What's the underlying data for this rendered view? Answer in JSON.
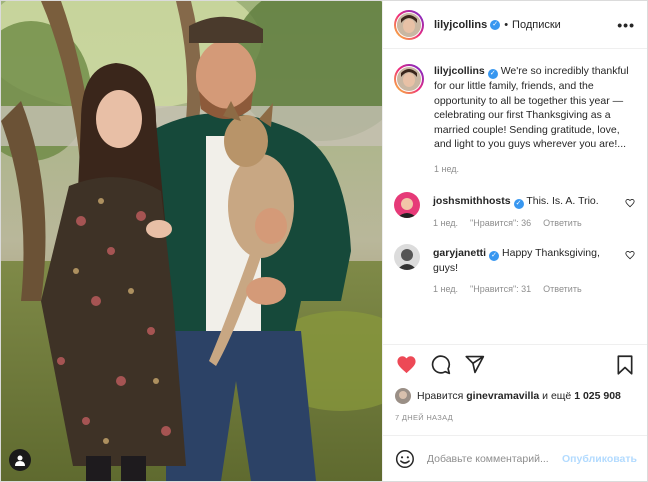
{
  "post": {
    "author": "lilyjcollins",
    "follow_state": "Подписки",
    "caption": "We're so incredibly thankful for our little family, friends, and the opportunity to all be together this year — celebrating our first Thanksgiving as a married couple! Sending gratitude, love, and light to you guys wherever you are!...",
    "caption_age": "1 нед."
  },
  "comments": [
    {
      "user": "joshsmithhosts",
      "text": "This. Is. A. Trio.",
      "age": "1 нед.",
      "likes": "\"Нравится\": 36",
      "reply": "Ответить"
    },
    {
      "user": "garyjanetti",
      "text": "Happy Thanksgiving, guys!",
      "age": "1 нед.",
      "likes": "\"Нравится\": 31",
      "reply": "Ответить"
    }
  ],
  "likes": {
    "prefix": "Нравится",
    "user": "ginevramavilla",
    "mid": "и ещё",
    "count": "1 025 908"
  },
  "posted_at": "7 ДНЕЙ НАЗАД",
  "comment_box": {
    "placeholder": "Добавьте комментарий...",
    "publish": "Опубликовать"
  },
  "icons": [
    "more-options-icon",
    "verified-badge-icon",
    "heart-icon",
    "comment-icon",
    "share-icon",
    "bookmark-icon",
    "emoji-icon",
    "user-tag-icon"
  ],
  "colors": {
    "like_red": "#ed4956",
    "verified_blue": "#3897f0",
    "publish_disabled": "#b3dbff",
    "meta_gray": "#8e8e8e"
  }
}
